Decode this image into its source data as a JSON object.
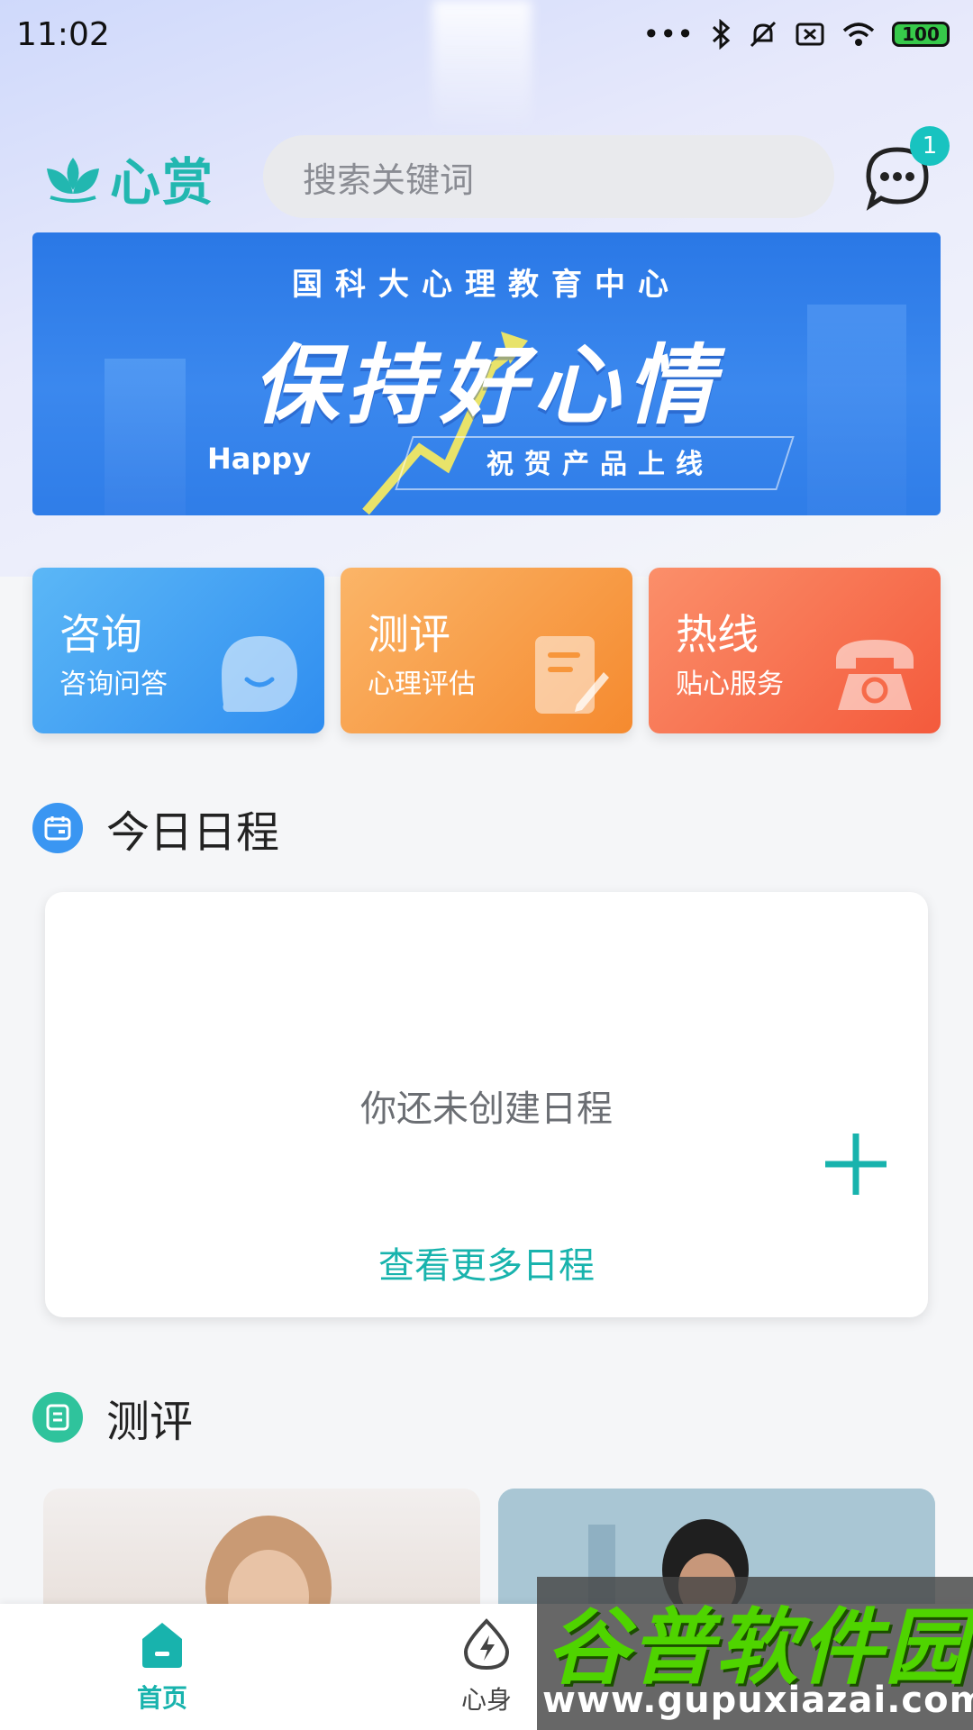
{
  "status_bar": {
    "time": "11:02",
    "battery": "100",
    "icons": [
      "more-dots-icon",
      "bluetooth-icon",
      "mute-icon",
      "sim-off-icon",
      "wifi-icon",
      "battery-icon"
    ]
  },
  "header": {
    "logo_text": "心赏",
    "search_placeholder": "搜索关键词",
    "message_badge": "1"
  },
  "banner": {
    "org": "国科大心理教育中心",
    "title": "保持好心情",
    "tag": "Happy",
    "subtitle": "祝贺产品上线"
  },
  "quick_cards": [
    {
      "title": "咨询",
      "subtitle": "咨询问答",
      "icon": "chat-bubble-icon",
      "color": "#3a96f2"
    },
    {
      "title": "测评",
      "subtitle": "心理评估",
      "icon": "document-edit-icon",
      "color": "#f7963b"
    },
    {
      "title": "热线",
      "subtitle": "贴心服务",
      "icon": "telephone-icon",
      "color": "#f66b4a"
    }
  ],
  "schedule": {
    "title": "今日日程",
    "empty_text": "你还未创建日程",
    "more_link": "查看更多日程"
  },
  "assessment": {
    "title": "测评"
  },
  "bottom_nav": [
    {
      "label": "首页",
      "icon": "home-icon",
      "active": true
    },
    {
      "label": "心身",
      "icon": "energy-drop-icon",
      "active": false
    }
  ],
  "watermark": {
    "title": "谷普软件园",
    "url": "www.gupuxiazai.com"
  },
  "colors": {
    "accent": "#18b3ad",
    "brand_teal": "#22b7b0"
  }
}
